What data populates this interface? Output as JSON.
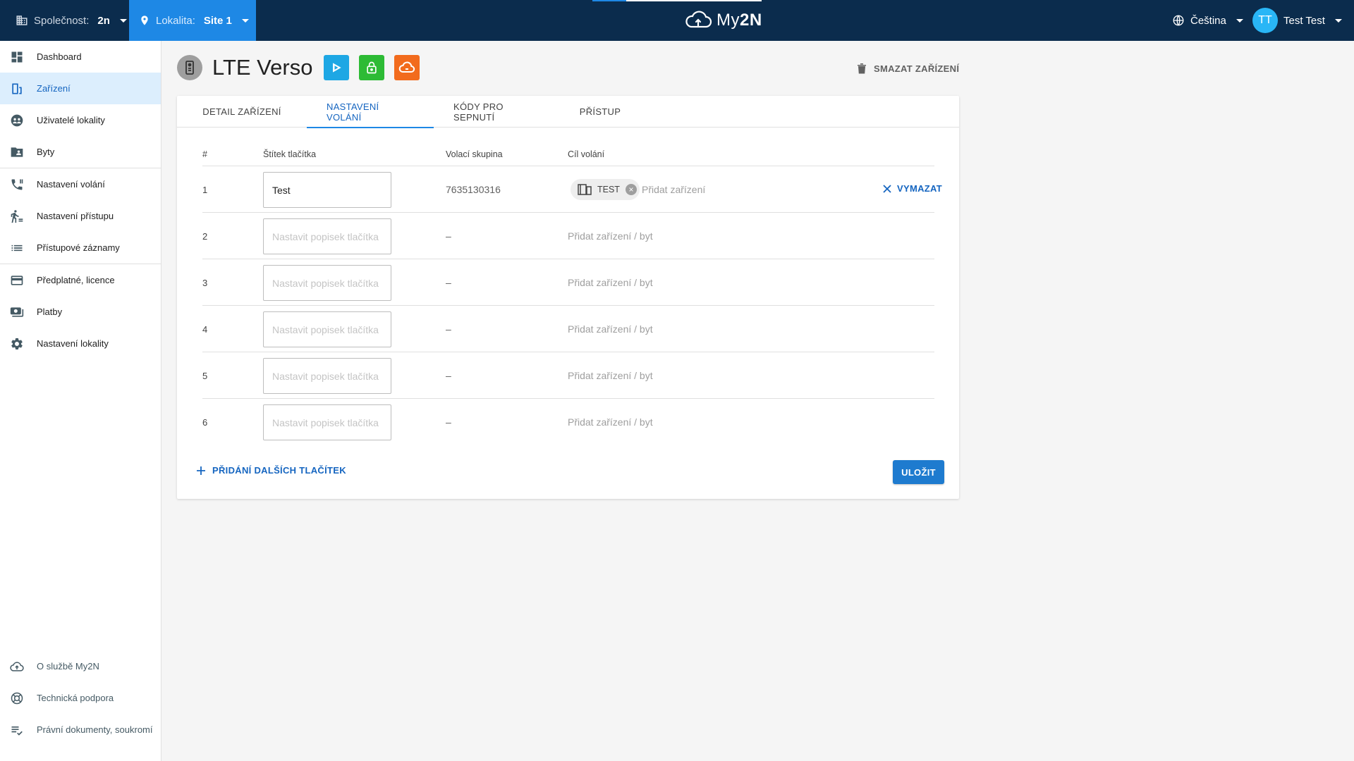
{
  "topbar": {
    "company_label": "Společnost:",
    "company_value": "2n",
    "site_label": "Lokalita:",
    "site_value": "Site 1",
    "logo_text_a": "My",
    "logo_text_b": "2N",
    "language": "Čeština",
    "user_initials": "TT",
    "user_name": "Test Test"
  },
  "sidebar": {
    "items": [
      {
        "label": "Dashboard",
        "icon": "dashboard-icon"
      },
      {
        "label": "Zařízení",
        "icon": "device-icon",
        "active": true
      },
      {
        "label": "Uživatelé lokality",
        "icon": "users-icon"
      },
      {
        "label": "Byty",
        "icon": "apartments-icon"
      },
      {
        "label": "Nastavení volání",
        "icon": "phone-settings-icon"
      },
      {
        "label": "Nastavení přístupu",
        "icon": "access-icon"
      },
      {
        "label": "Přístupové záznamy",
        "icon": "list-icon"
      },
      {
        "label": "Předplatné, licence",
        "icon": "card-icon"
      },
      {
        "label": "Platby",
        "icon": "payments-icon"
      },
      {
        "label": "Nastavení lokality",
        "icon": "gear-icon"
      }
    ],
    "bottom_items": [
      {
        "label": "O službě My2N",
        "icon": "cloud-icon"
      },
      {
        "label": "Technická podpora",
        "icon": "support-icon"
      },
      {
        "label": "Právní dokumenty, soukromí",
        "icon": "legal-icon"
      }
    ]
  },
  "header": {
    "title": "LTE Verso",
    "delete_label": "SMAZAT ZAŘÍZENÍ"
  },
  "tabs": [
    {
      "label": "DETAIL ZAŘÍZENÍ"
    },
    {
      "label": "NASTAVENÍ VOLÁNÍ",
      "active": true
    },
    {
      "label": "KÓDY PRO SEPNUTÍ"
    },
    {
      "label": "PŘÍSTUP"
    }
  ],
  "table": {
    "headers": {
      "num": "#",
      "label": "Štítek tlačítka",
      "group": "Volací skupina",
      "target": "Cíl volání"
    },
    "placeholder": "Nastavit popisek tlačítka",
    "rows": [
      {
        "num": "1",
        "value": "Test",
        "group": "7635130316",
        "chip": "TEST",
        "add_device": "Přidat zařízení",
        "clear": "VYMAZAT"
      },
      {
        "num": "2",
        "value": "",
        "group": "–",
        "target": "Přidat zařízení / byt"
      },
      {
        "num": "3",
        "value": "",
        "group": "–",
        "target": "Přidat zařízení / byt"
      },
      {
        "num": "4",
        "value": "",
        "group": "–",
        "target": "Přidat zařízení / byt"
      },
      {
        "num": "5",
        "value": "",
        "group": "–",
        "target": "Přidat zařízení / byt"
      },
      {
        "num": "6",
        "value": "",
        "group": "–",
        "target": "Přidat zařízení / byt"
      }
    ]
  },
  "footer": {
    "add_more": "PŘIDÁNÍ DALŠÍCH TLAČÍTEK",
    "save": "ULOŽIT"
  },
  "colors": {
    "topbar": "#0b2c4d",
    "accent": "#1e88e5",
    "save": "#1e7bcf"
  }
}
